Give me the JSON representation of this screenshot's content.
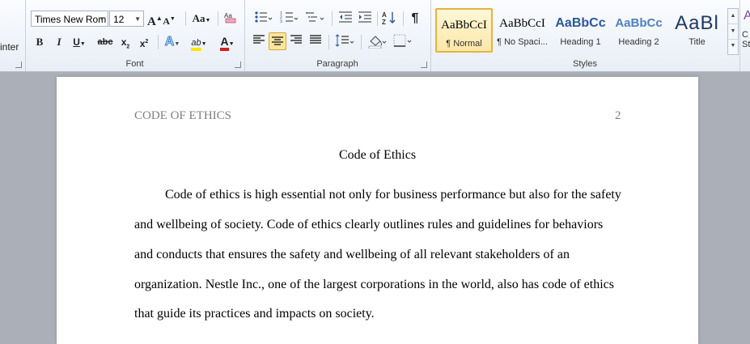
{
  "clipboard": {
    "format_painter_label": "inter"
  },
  "font": {
    "family": "Times New Rom",
    "size": "12",
    "grow_label": "A",
    "shrink_label": "A",
    "change_case_label": "Aa",
    "bold_label": "B",
    "italic_label": "I",
    "underline_label": "U",
    "strike_label": "abc",
    "subscript_label": "x",
    "subscript_index": "2",
    "superscript_label": "x",
    "superscript_index": "2",
    "effects_label": "A",
    "highlight_label": "ab",
    "color_label": "A",
    "group_label": "Font"
  },
  "paragraph": {
    "pilcrow": "¶",
    "group_label": "Paragraph"
  },
  "styles": {
    "items": [
      {
        "preview": "AaBbCcI",
        "name": "¶ Normal"
      },
      {
        "preview": "AaBbCcI",
        "name": "¶ No Spaci..."
      },
      {
        "preview": "AaBbCc",
        "name": "Heading 1"
      },
      {
        "preview": "AaBbCc",
        "name": "Heading 2"
      },
      {
        "preview": "AaBl",
        "name": "Title"
      }
    ],
    "group_label": "Styles",
    "change_partial_1": "C",
    "change_partial_2": "St"
  },
  "colors": {
    "highlight": "#ffe800",
    "font_color": "#d21f1f",
    "selected_border": "#e3b33f",
    "accent_blue": "#2b579a"
  },
  "document": {
    "header_title": "CODE OF ETHICS",
    "page_number": "2",
    "title": "Code of Ethics",
    "lines": [
      "Code of ethics is high essential not only for business performance but also for the safety",
      "and wellbeing of society. Code of ethics clearly outlines rules and guidelines for behaviors",
      "and conducts that ensures the safety and wellbeing of all relevant stakeholders of an",
      "organization. Nestle Inc., one of the largest corporations in the world, also has code of ethics",
      "that guide its practices and impacts on society."
    ]
  }
}
